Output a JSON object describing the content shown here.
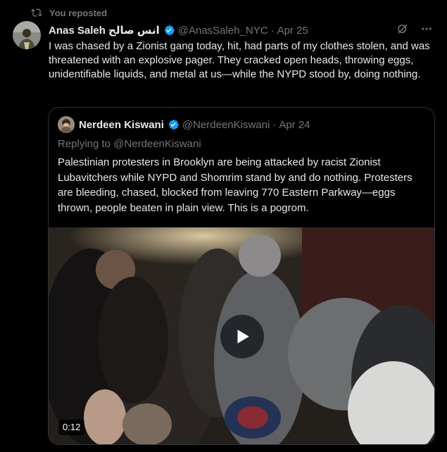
{
  "repost": {
    "label": "You reposted",
    "icon": "repost-icon"
  },
  "post": {
    "author_name": "Anas Saleh انس صالح",
    "handle": "@AnasSaleh_NYC",
    "date": "Apr 25",
    "text": "I was chased by a Zionist gang today, hit, had parts of my clothes stolen, and was threatened with an explosive pager. They cracked open heads, throwing eggs, unidentifiable liquids, and metal at us—while the NYPD stood by, doing nothing.",
    "verified_color": "#1d9bf0",
    "actions": [
      "grok-icon",
      "more-icon"
    ]
  },
  "quote": {
    "author_name": "Nerdeen Kiswani",
    "handle": "@NerdeenKiswani",
    "date": "Apr 24",
    "replying_to": "Replying to @NerdeenKiswani",
    "text": "Palestinian protesters in Brooklyn are being attacked by racist Zionist Lubavitchers while NYPD and Shomrim stand by and do nothing. Protesters are bleeding, chased, blocked from leaving 770 Eastern Parkway—eggs thrown, people beaten in plain view. This is a pogrom.",
    "video_duration": "0:12"
  }
}
